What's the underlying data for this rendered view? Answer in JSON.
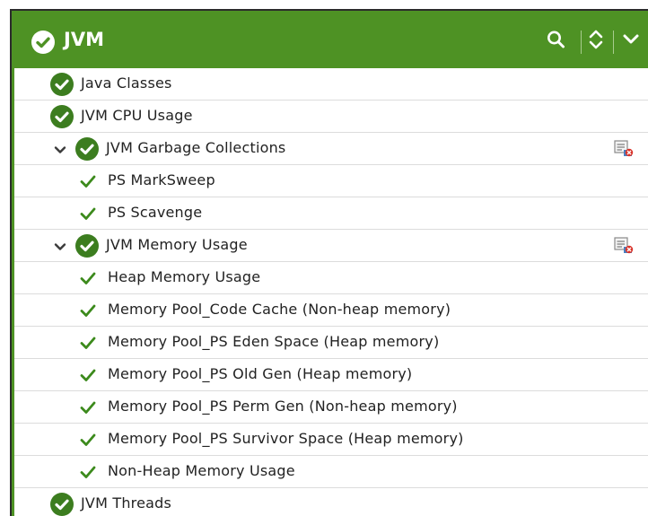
{
  "header": {
    "title": "JVM",
    "icons": [
      "check-circle-icon",
      "search-icon",
      "expand-collapse-icon",
      "chevron-down-icon"
    ]
  },
  "colors": {
    "header_bg": "#4e9224",
    "status_ok": "#3c7d1f",
    "tick": "#3c8a1c",
    "border": "#2b2b2b"
  },
  "tree": {
    "items": [
      {
        "label": "Java Classes",
        "level": 0,
        "status": "ok"
      },
      {
        "label": "JVM CPU Usage",
        "level": 0,
        "status": "ok"
      },
      {
        "label": "JVM Garbage Collections",
        "level": 1,
        "status": "ok",
        "expanded": true,
        "has_report": true
      },
      {
        "label": "PS MarkSweep",
        "level": 2,
        "status": "ok"
      },
      {
        "label": "PS Scavenge",
        "level": 2,
        "status": "ok"
      },
      {
        "label": "JVM Memory Usage",
        "level": 1,
        "status": "ok",
        "expanded": true,
        "has_report": true
      },
      {
        "label": "Heap Memory Usage",
        "level": 2,
        "status": "ok"
      },
      {
        "label": "Memory Pool_Code Cache (Non-heap memory)",
        "level": 2,
        "status": "ok"
      },
      {
        "label": "Memory Pool_PS Eden Space (Heap memory)",
        "level": 2,
        "status": "ok"
      },
      {
        "label": "Memory Pool_PS Old Gen (Heap memory)",
        "level": 2,
        "status": "ok"
      },
      {
        "label": "Memory Pool_PS Perm Gen (Non-heap memory)",
        "level": 2,
        "status": "ok"
      },
      {
        "label": "Memory Pool_PS Survivor Space (Heap memory)",
        "level": 2,
        "status": "ok"
      },
      {
        "label": "Non-Heap Memory Usage",
        "level": 2,
        "status": "ok"
      },
      {
        "label": "JVM Threads",
        "level": 0,
        "status": "ok"
      }
    ]
  }
}
